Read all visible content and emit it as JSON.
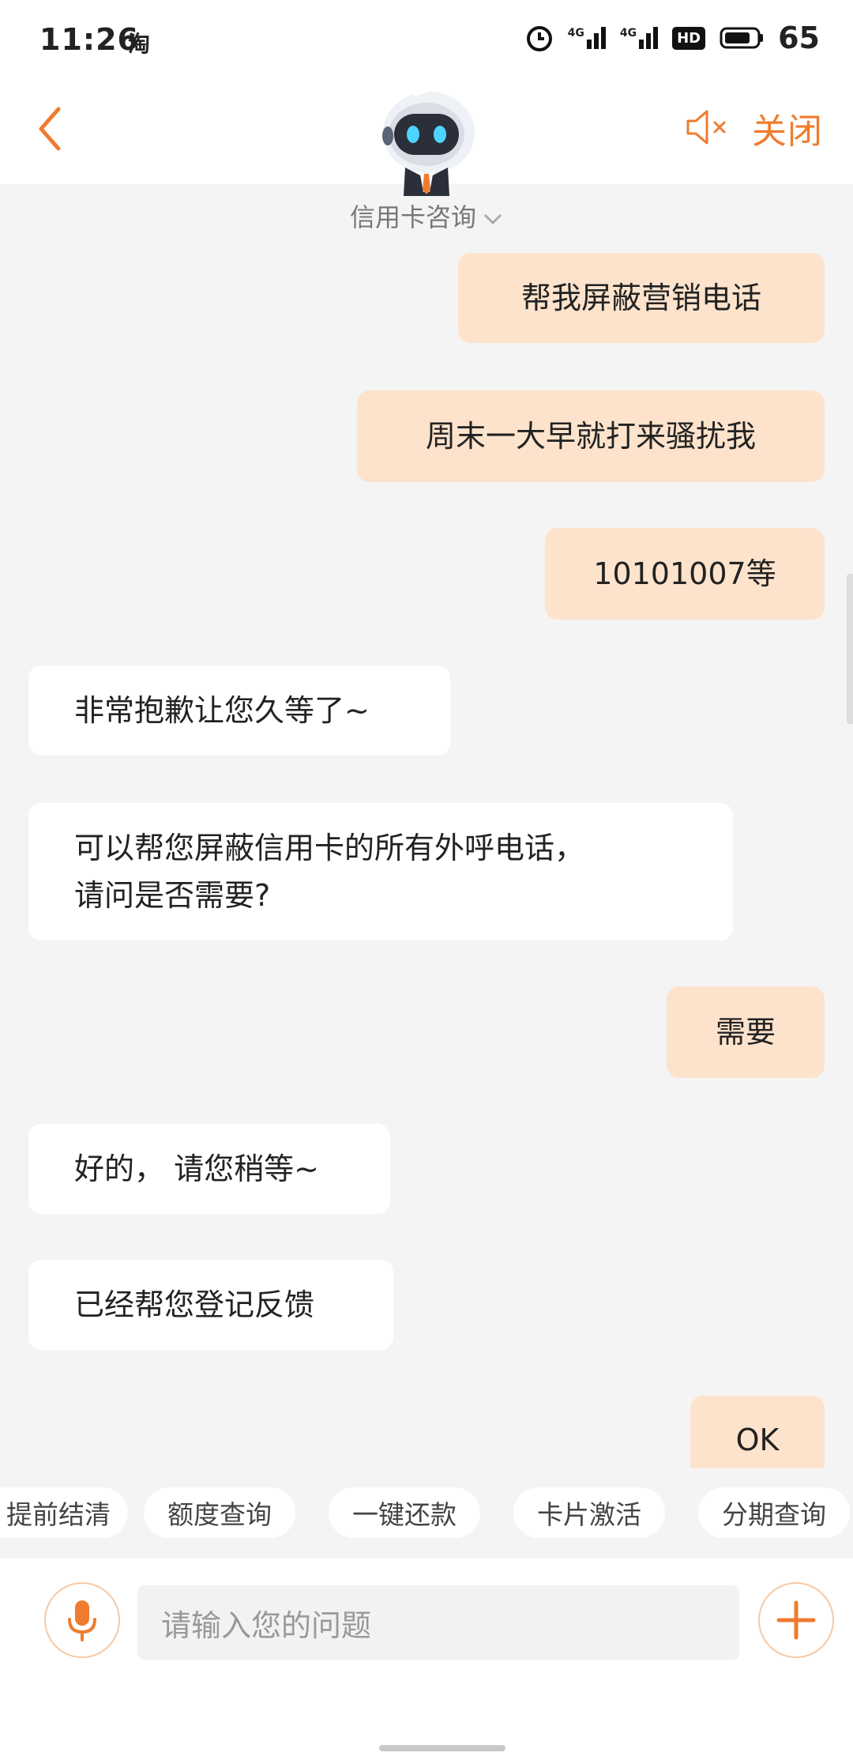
{
  "status_bar": {
    "time": "11:26",
    "app_icon_text": "淘",
    "battery": "65",
    "net1": "4G",
    "net2": "4G",
    "hd": "HD"
  },
  "header": {
    "topic": "信用卡咨询",
    "close_label": "关闭"
  },
  "messages": [
    {
      "from": "user",
      "text": "帮我屏蔽营销电话"
    },
    {
      "from": "user",
      "text": "周末一大早就打来骚扰我"
    },
    {
      "from": "user",
      "text": "10101007等"
    },
    {
      "from": "bot",
      "text": "非常抱歉让您久等了~"
    },
    {
      "from": "bot",
      "text_line1": "可以帮您屏蔽信用卡的所有外呼电话，",
      "text_line2": "请问是否需要?"
    },
    {
      "from": "user",
      "text": "需要"
    },
    {
      "from": "bot",
      "text": "好的， 请您稍等~"
    },
    {
      "from": "bot",
      "text": "已经帮您登记反馈"
    },
    {
      "from": "user",
      "text": "OK"
    }
  ],
  "quick_actions": [
    "提前结清",
    "额度查询",
    "一键还款",
    "卡片激活",
    "分期查询"
  ],
  "input": {
    "placeholder": "请输入您的问题"
  },
  "colors": {
    "accent": "#ef7c2e",
    "user_bubble": "#fde3cc",
    "bot_bubble": "#ffffff",
    "background": "#f4f4f4"
  }
}
